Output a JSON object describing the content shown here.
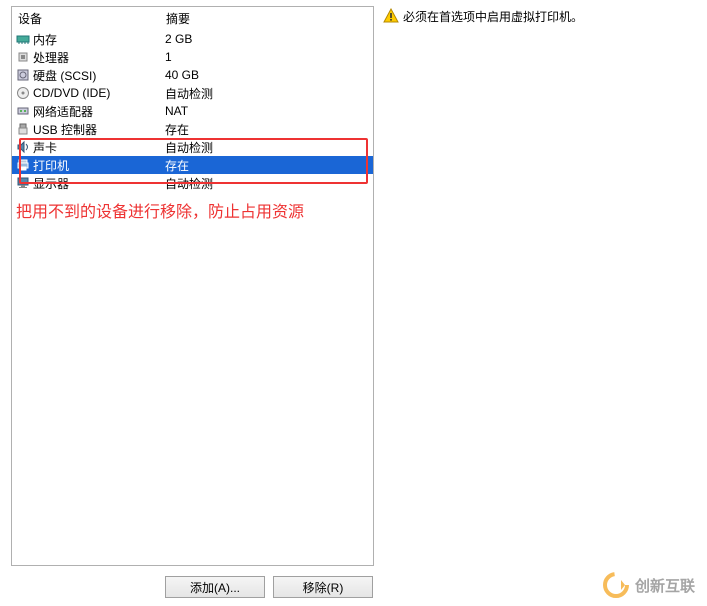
{
  "headers": {
    "device": "设备",
    "summary": "摘要"
  },
  "rows": [
    {
      "icon": "memory-icon",
      "name": "内存",
      "summary": "2 GB",
      "selected": false
    },
    {
      "icon": "cpu-icon",
      "name": "处理器",
      "summary": "1",
      "selected": false
    },
    {
      "icon": "disk-icon",
      "name": "硬盘 (SCSI)",
      "summary": "40 GB",
      "selected": false
    },
    {
      "icon": "cd-icon",
      "name": "CD/DVD (IDE)",
      "summary": "自动检测",
      "selected": false
    },
    {
      "icon": "network-icon",
      "name": "网络适配器",
      "summary": "NAT",
      "selected": false
    },
    {
      "icon": "usb-icon",
      "name": "USB 控制器",
      "summary": "存在",
      "selected": false
    },
    {
      "icon": "sound-icon",
      "name": "声卡",
      "summary": "自动检测",
      "selected": false
    },
    {
      "icon": "printer-icon",
      "name": "打印机",
      "summary": "存在",
      "selected": true
    },
    {
      "icon": "display-icon",
      "name": "显示器",
      "summary": "自动检测",
      "selected": false
    }
  ],
  "annotation": "把用不到的设备进行移除，防止占用资源",
  "warning": "必须在首选项中启用虚拟打印机。",
  "buttons": {
    "add": "添加(A)...",
    "remove": "移除(R)"
  },
  "watermark": "创新互联"
}
